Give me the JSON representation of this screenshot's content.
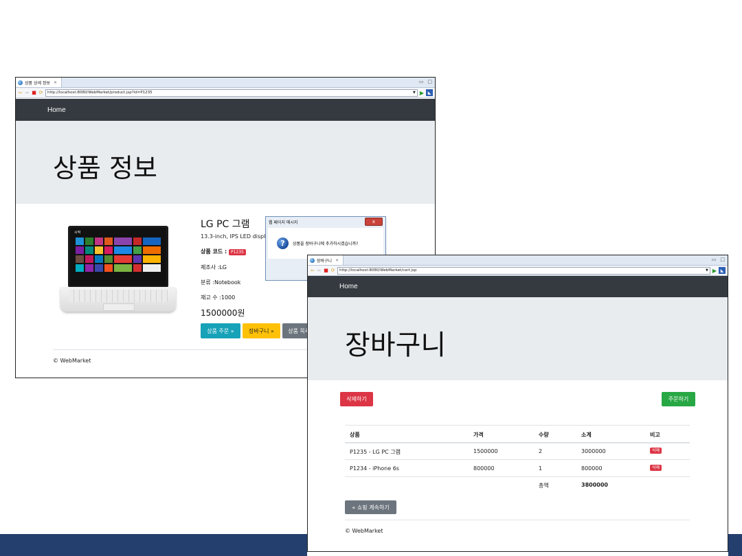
{
  "product_window": {
    "tab_title": "상품 상세 정보",
    "url": "http://localhost:8080/WebMarket/product.jsp?id=P1235",
    "nav_home": "Home",
    "jumbotron_title": "상품 정보",
    "product": {
      "name": "LG PC 그램",
      "description": "13.3-inch, IPS LED display",
      "code_label": "상품 코드 : ",
      "code": "P1235",
      "manufacturer": "제조사 :LG",
      "category": "분류 :Notebook",
      "stock": "재고 수 :1000",
      "price": "1500000원"
    },
    "buttons": {
      "order": "상품 주문 »",
      "cart": "장바구니 »",
      "list": "상품 목록 »"
    },
    "footer": "© WebMarket"
  },
  "dialog": {
    "title": "웹 페이지 메시지",
    "message": "상품을 장바구니에 추가하시겠습니까?",
    "close_glyph": "x"
  },
  "cart_window": {
    "tab_title": "장바구니",
    "url": "http://localhost:8080/WebMarket/cart.jsp",
    "nav_home": "Home",
    "jumbotron_title": "장바구니",
    "delete_all_button": "삭제하기",
    "order_button": "주문하기",
    "table": {
      "headers": [
        "상품",
        "가격",
        "수량",
        "소계",
        "비고"
      ],
      "rows": [
        {
          "product": "P1235 - LG PC 그램",
          "price": "1500000",
          "qty": "2",
          "subtotal": "3000000",
          "action": "삭제"
        },
        {
          "product": "P1234 - iPhone 6s",
          "price": "800000",
          "qty": "1",
          "subtotal": "800000",
          "action": "삭제"
        }
      ],
      "total_label": "총액",
      "total_value": "3800000"
    },
    "continue_button": "« 쇼핑 계속하기",
    "footer": "© WebMarket"
  },
  "colors": {
    "navbar": "#343a40",
    "jumbotron": "#e9ecef",
    "danger": "#dc3545",
    "success": "#28a745",
    "info": "#17a2b8",
    "warning": "#ffc107",
    "secondary": "#6c757d",
    "bottom_band": "#243f6e"
  }
}
